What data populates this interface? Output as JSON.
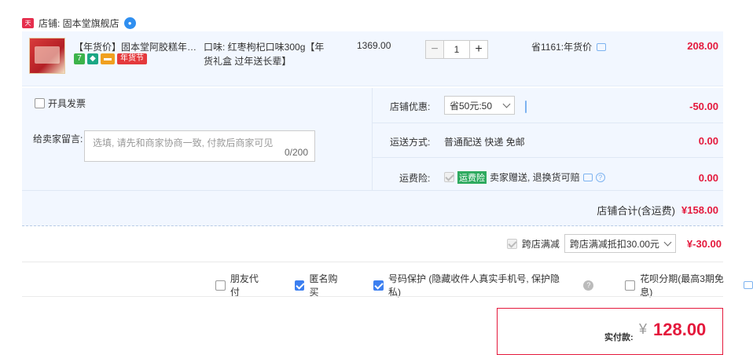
{
  "store": {
    "tag": "天猫",
    "name": "店铺: 固本堂旗舰店",
    "ww_icon": "wangwang-icon"
  },
  "item": {
    "title": "【年货价】固本堂阿胶糕年货礼...",
    "badges": {
      "seven": "7",
      "festival": "年货节"
    },
    "spec": "口味: 红枣枸杞口味300g【年货礼盒 过年送长辈】",
    "price": "1369.00",
    "qty_minus": "−",
    "qty": "1",
    "qty_plus": "+",
    "save": "省1161:年货价",
    "total": "208.00"
  },
  "panel": {
    "invoice_label": "开具发票",
    "msg_label": "给卖家留言:",
    "msg_placeholder": "选填, 请先和商家协商一致, 付款后商家可见",
    "msg_count": "0/200",
    "discount_label": "店铺优惠:",
    "discount_select": "省50元:50",
    "discount_amt": "-50.00",
    "ship_label": "运送方式:",
    "ship_value": "普通配送 快递 免邮",
    "ship_amt": "0.00",
    "insure_label": "运费险:",
    "insure_tag": "运费险",
    "insure_text": "卖家赠送, 退换货可赔",
    "insure_amt": "0.00",
    "store_total_label": "店铺合计(含运费)",
    "store_total_amt": "¥158.00"
  },
  "cross": {
    "label": "跨店满减",
    "select": "跨店满减抵扣30.00元",
    "amt": "¥-30.00"
  },
  "options": {
    "friend_pay": "朋友代付",
    "anonymous": "匿名购买",
    "number_protect": "号码保护 (隐藏收件人真实手机号, 保护隐私)",
    "huabei": "花呗分期(最高3期免息)"
  },
  "pay": {
    "label": "实付款:",
    "currency": "¥",
    "amount": "128.00"
  },
  "colors": {
    "accent_red": "#e4193c",
    "panel_bg": "#f2f7ff",
    "checkbox_blue": "#3c7ff0"
  }
}
